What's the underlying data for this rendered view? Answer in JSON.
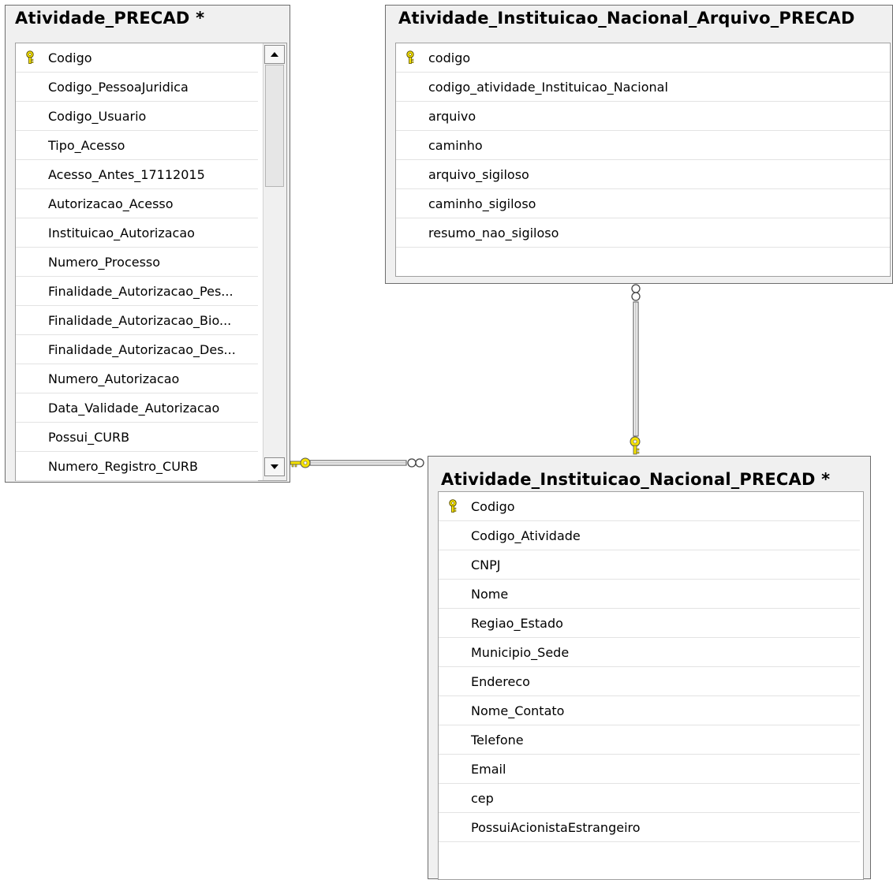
{
  "tables": {
    "atividade": {
      "title": "Atividade_PRECAD *",
      "columns": [
        "Codigo",
        "Codigo_PessoaJuridica",
        "Codigo_Usuario",
        "Tipo_Acesso",
        "Acesso_Antes_17112015",
        "Autorizacao_Acesso",
        "Instituicao_Autorizacao",
        "Numero_Processo",
        "Finalidade_Autorizacao_Pes...",
        "Finalidade_Autorizacao_Bio...",
        "Finalidade_Autorizacao_Des...",
        "Numero_Autorizacao",
        "Data_Validade_Autorizacao",
        "Possui_CURB",
        "Numero_Registro_CURB"
      ],
      "primary_key": "Codigo"
    },
    "arquivo": {
      "title": "Atividade_Instituicao_Nacional_Arquivo_PRECAD",
      "columns": [
        "codigo",
        "codigo_atividade_Instituicao_Nacional",
        "arquivo",
        "caminho",
        "arquivo_sigiloso",
        "caminho_sigiloso",
        "resumo_nao_sigiloso"
      ],
      "primary_key": "codigo"
    },
    "instituicao": {
      "title": "Atividade_Instituicao_Nacional_PRECAD *",
      "columns": [
        "Codigo",
        "Codigo_Atividade",
        "CNPJ",
        "Nome",
        "Regiao_Estado",
        "Municipio_Sede",
        "Endereco",
        "Nome_Contato",
        "Telefone",
        "Email",
        "cep",
        "PossuiAcionistaEstrangeiro"
      ],
      "primary_key": "Codigo"
    }
  },
  "relationships": [
    {
      "from": "Atividade_PRECAD",
      "to": "Atividade_Instituicao_Nacional_PRECAD",
      "one_end": "key",
      "many_end": "infinity"
    },
    {
      "from": "Atividade_Instituicao_Nacional_PRECAD",
      "to": "Atividade_Instituicao_Nacional_Arquivo_PRECAD",
      "one_end": "key",
      "many_end": "infinity"
    }
  ],
  "colors": {
    "key": "#f5e200",
    "line": "#6a6a6a"
  }
}
